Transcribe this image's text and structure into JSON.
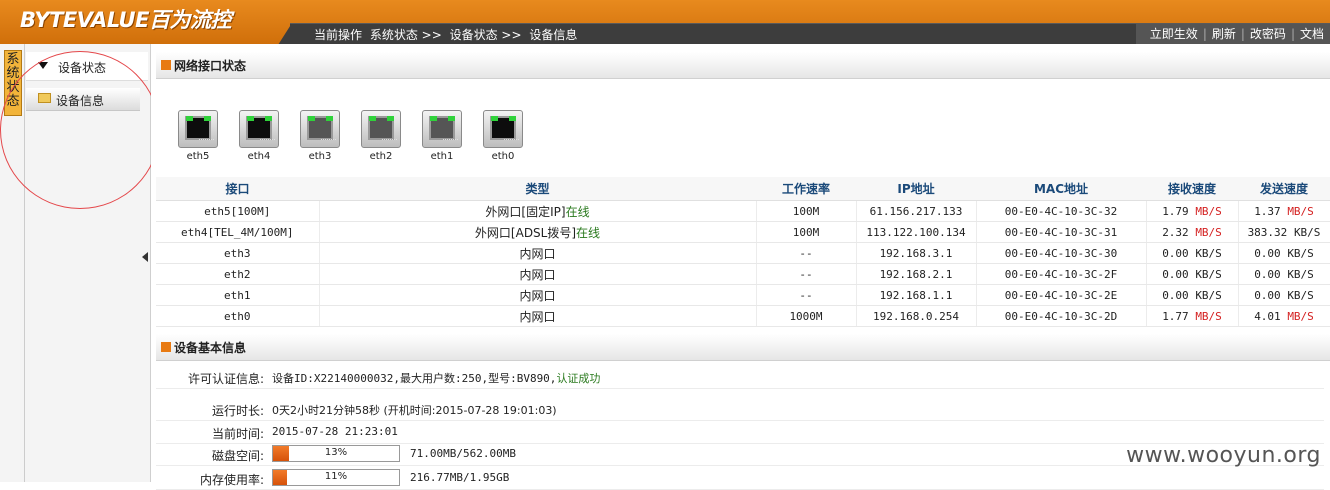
{
  "header": {
    "logo": "BYTEVALUE百为流控",
    "breadcrumb": [
      "当前操作",
      "系统状态 >>",
      "设备状态 >>",
      "设备信息"
    ],
    "links": [
      "立即生效",
      "刷新",
      "改密码",
      "文档"
    ]
  },
  "sidebar": {
    "vertical_tab": "系统状态",
    "group_label": "设备状态",
    "item_label": "设备信息"
  },
  "network": {
    "title": "网络接口状态",
    "ports": [
      {
        "name": "eth5",
        "state": "active"
      },
      {
        "name": "eth4",
        "state": "active"
      },
      {
        "name": "eth3",
        "state": "idle"
      },
      {
        "name": "eth2",
        "state": "idle"
      },
      {
        "name": "eth1",
        "state": "idle"
      },
      {
        "name": "eth0",
        "state": "active"
      }
    ],
    "columns": [
      "接口",
      "类型",
      "工作速率",
      "IP地址",
      "MAC地址",
      "接收速度",
      "发送速度"
    ],
    "rows": [
      {
        "iface": "eth5[100M]",
        "type": "外网口[固定IP]",
        "status": "在线",
        "speed": "100M",
        "ip": "61.156.217.133",
        "mac": "00-E0-4C-10-3C-32",
        "rx_num": "1.79",
        "rx_unit": "MB/S",
        "tx_num": "1.37",
        "tx_unit": "MB/S"
      },
      {
        "iface": "eth4[TEL_4M/100M]",
        "type": "外网口[ADSL拨号]",
        "status": "在线",
        "speed": "100M",
        "ip": "113.122.100.134",
        "mac": "00-E0-4C-10-3C-31",
        "rx_num": "2.32",
        "rx_unit": "MB/S",
        "tx_num": "383.32",
        "tx_unit": "KB/S"
      },
      {
        "iface": "eth3",
        "type": "内网口",
        "status": "",
        "speed": "--",
        "ip": "192.168.3.1",
        "mac": "00-E0-4C-10-3C-30",
        "rx_num": "0.00",
        "rx_unit": "KB/S",
        "tx_num": "0.00",
        "tx_unit": "KB/S"
      },
      {
        "iface": "eth2",
        "type": "内网口",
        "status": "",
        "speed": "--",
        "ip": "192.168.2.1",
        "mac": "00-E0-4C-10-3C-2F",
        "rx_num": "0.00",
        "rx_unit": "KB/S",
        "tx_num": "0.00",
        "tx_unit": "KB/S"
      },
      {
        "iface": "eth1",
        "type": "内网口",
        "status": "",
        "speed": "--",
        "ip": "192.168.1.1",
        "mac": "00-E0-4C-10-3C-2E",
        "rx_num": "0.00",
        "rx_unit": "KB/S",
        "tx_num": "0.00",
        "tx_unit": "KB/S"
      },
      {
        "iface": "eth0",
        "type": "内网口",
        "status": "",
        "speed": "1000M",
        "ip": "192.168.0.254",
        "mac": "00-E0-4C-10-3C-2D",
        "rx_num": "1.77",
        "rx_unit": "MB/S",
        "tx_num": "4.01",
        "tx_unit": "MB/S"
      }
    ]
  },
  "device": {
    "title": "设备基本信息",
    "license_label": "许可认证信息:",
    "license_value": "设备ID:X22140000032,最大用户数:250,型号:BV890,",
    "license_status": "认证成功",
    "uptime_label": "运行时长:",
    "uptime_value": "0天2小时21分钟58秒 (开机时间:2015-07-28 19:01:03)",
    "time_label": "当前时间:",
    "time_value": "2015-07-28 21:23:01",
    "disk_label": "磁盘空间:",
    "disk_percent": 13,
    "disk_percent_text": "13%",
    "disk_usage": "71.00MB/562.00MB",
    "mem_label": "内存使用率:",
    "mem_percent": 11,
    "mem_percent_text": "11%",
    "mem_usage": "216.77MB/1.95GB"
  },
  "colors": {
    "accent": "#e07d14",
    "header_dark": "#3d3d3d",
    "online": "#2a7a1e",
    "mb_unit": "#d42020",
    "annotation": "#e4474a"
  },
  "watermark": "www.wooyun.org"
}
